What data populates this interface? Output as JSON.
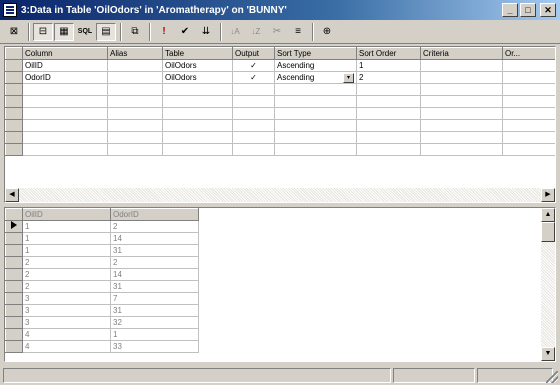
{
  "window": {
    "title": "3:Data in Table 'OilOdors' in 'Aromatherapy' on 'BUNNY'",
    "minimize_glyph": "_",
    "maximize_glyph": "□",
    "close_glyph": "✕"
  },
  "toolbar": {
    "buttons": [
      {
        "name": "design-mode-icon",
        "glyph": "⊠"
      },
      {
        "name": "diagram-pane-icon",
        "glyph": "⊟"
      },
      {
        "name": "grid-pane-icon",
        "glyph": "▦"
      },
      {
        "name": "sql-pane-icon",
        "glyph": "SQL"
      },
      {
        "name": "results-pane-icon",
        "glyph": "▤"
      },
      {
        "name": "change-query-type-icon",
        "glyph": "⧉"
      },
      {
        "name": "run-icon",
        "glyph": "!"
      },
      {
        "name": "verify-sql-icon",
        "glyph": "✔"
      },
      {
        "name": "group-by-icon",
        "glyph": "⇊"
      },
      {
        "name": "sort-ascending-icon",
        "glyph": "↓A"
      },
      {
        "name": "sort-descending-icon",
        "glyph": "↓Z"
      },
      {
        "name": "remove-filter-icon",
        "glyph": "✂"
      },
      {
        "name": "use-group-by-icon",
        "glyph": "≡"
      },
      {
        "name": "add-table-icon",
        "glyph": "⊕"
      }
    ]
  },
  "grid": {
    "columns": [
      "Column",
      "Alias",
      "Table",
      "Output",
      "Sort Type",
      "Sort Order",
      "Criteria",
      "Or..."
    ],
    "rows": [
      {
        "column": "OilID",
        "alias": "",
        "table": "OilOdors",
        "output": "✓",
        "sort_type": "Ascending",
        "sort_order": "1",
        "criteria": "",
        "or": ""
      },
      {
        "column": "OdorID",
        "alias": "",
        "table": "OilOdors",
        "output": "✓",
        "sort_type": "Ascending",
        "sort_order": "2",
        "criteria": "",
        "or": ""
      }
    ],
    "empty_rows": 6
  },
  "results": {
    "columns": [
      "OilID",
      "OdorID"
    ],
    "rows": [
      [
        "1",
        "2"
      ],
      [
        "1",
        "14"
      ],
      [
        "1",
        "31"
      ],
      [
        "2",
        "2"
      ],
      [
        "2",
        "14"
      ],
      [
        "2",
        "31"
      ],
      [
        "3",
        "7"
      ],
      [
        "3",
        "31"
      ],
      [
        "3",
        "32"
      ],
      [
        "4",
        "1"
      ],
      [
        "4",
        "33"
      ]
    ],
    "selected_row": 0
  },
  "scroll": {
    "left_arrow": "◀",
    "right_arrow": "▶",
    "up_arrow": "▲",
    "down_arrow": "▼",
    "dropdown_arrow": "▾"
  }
}
